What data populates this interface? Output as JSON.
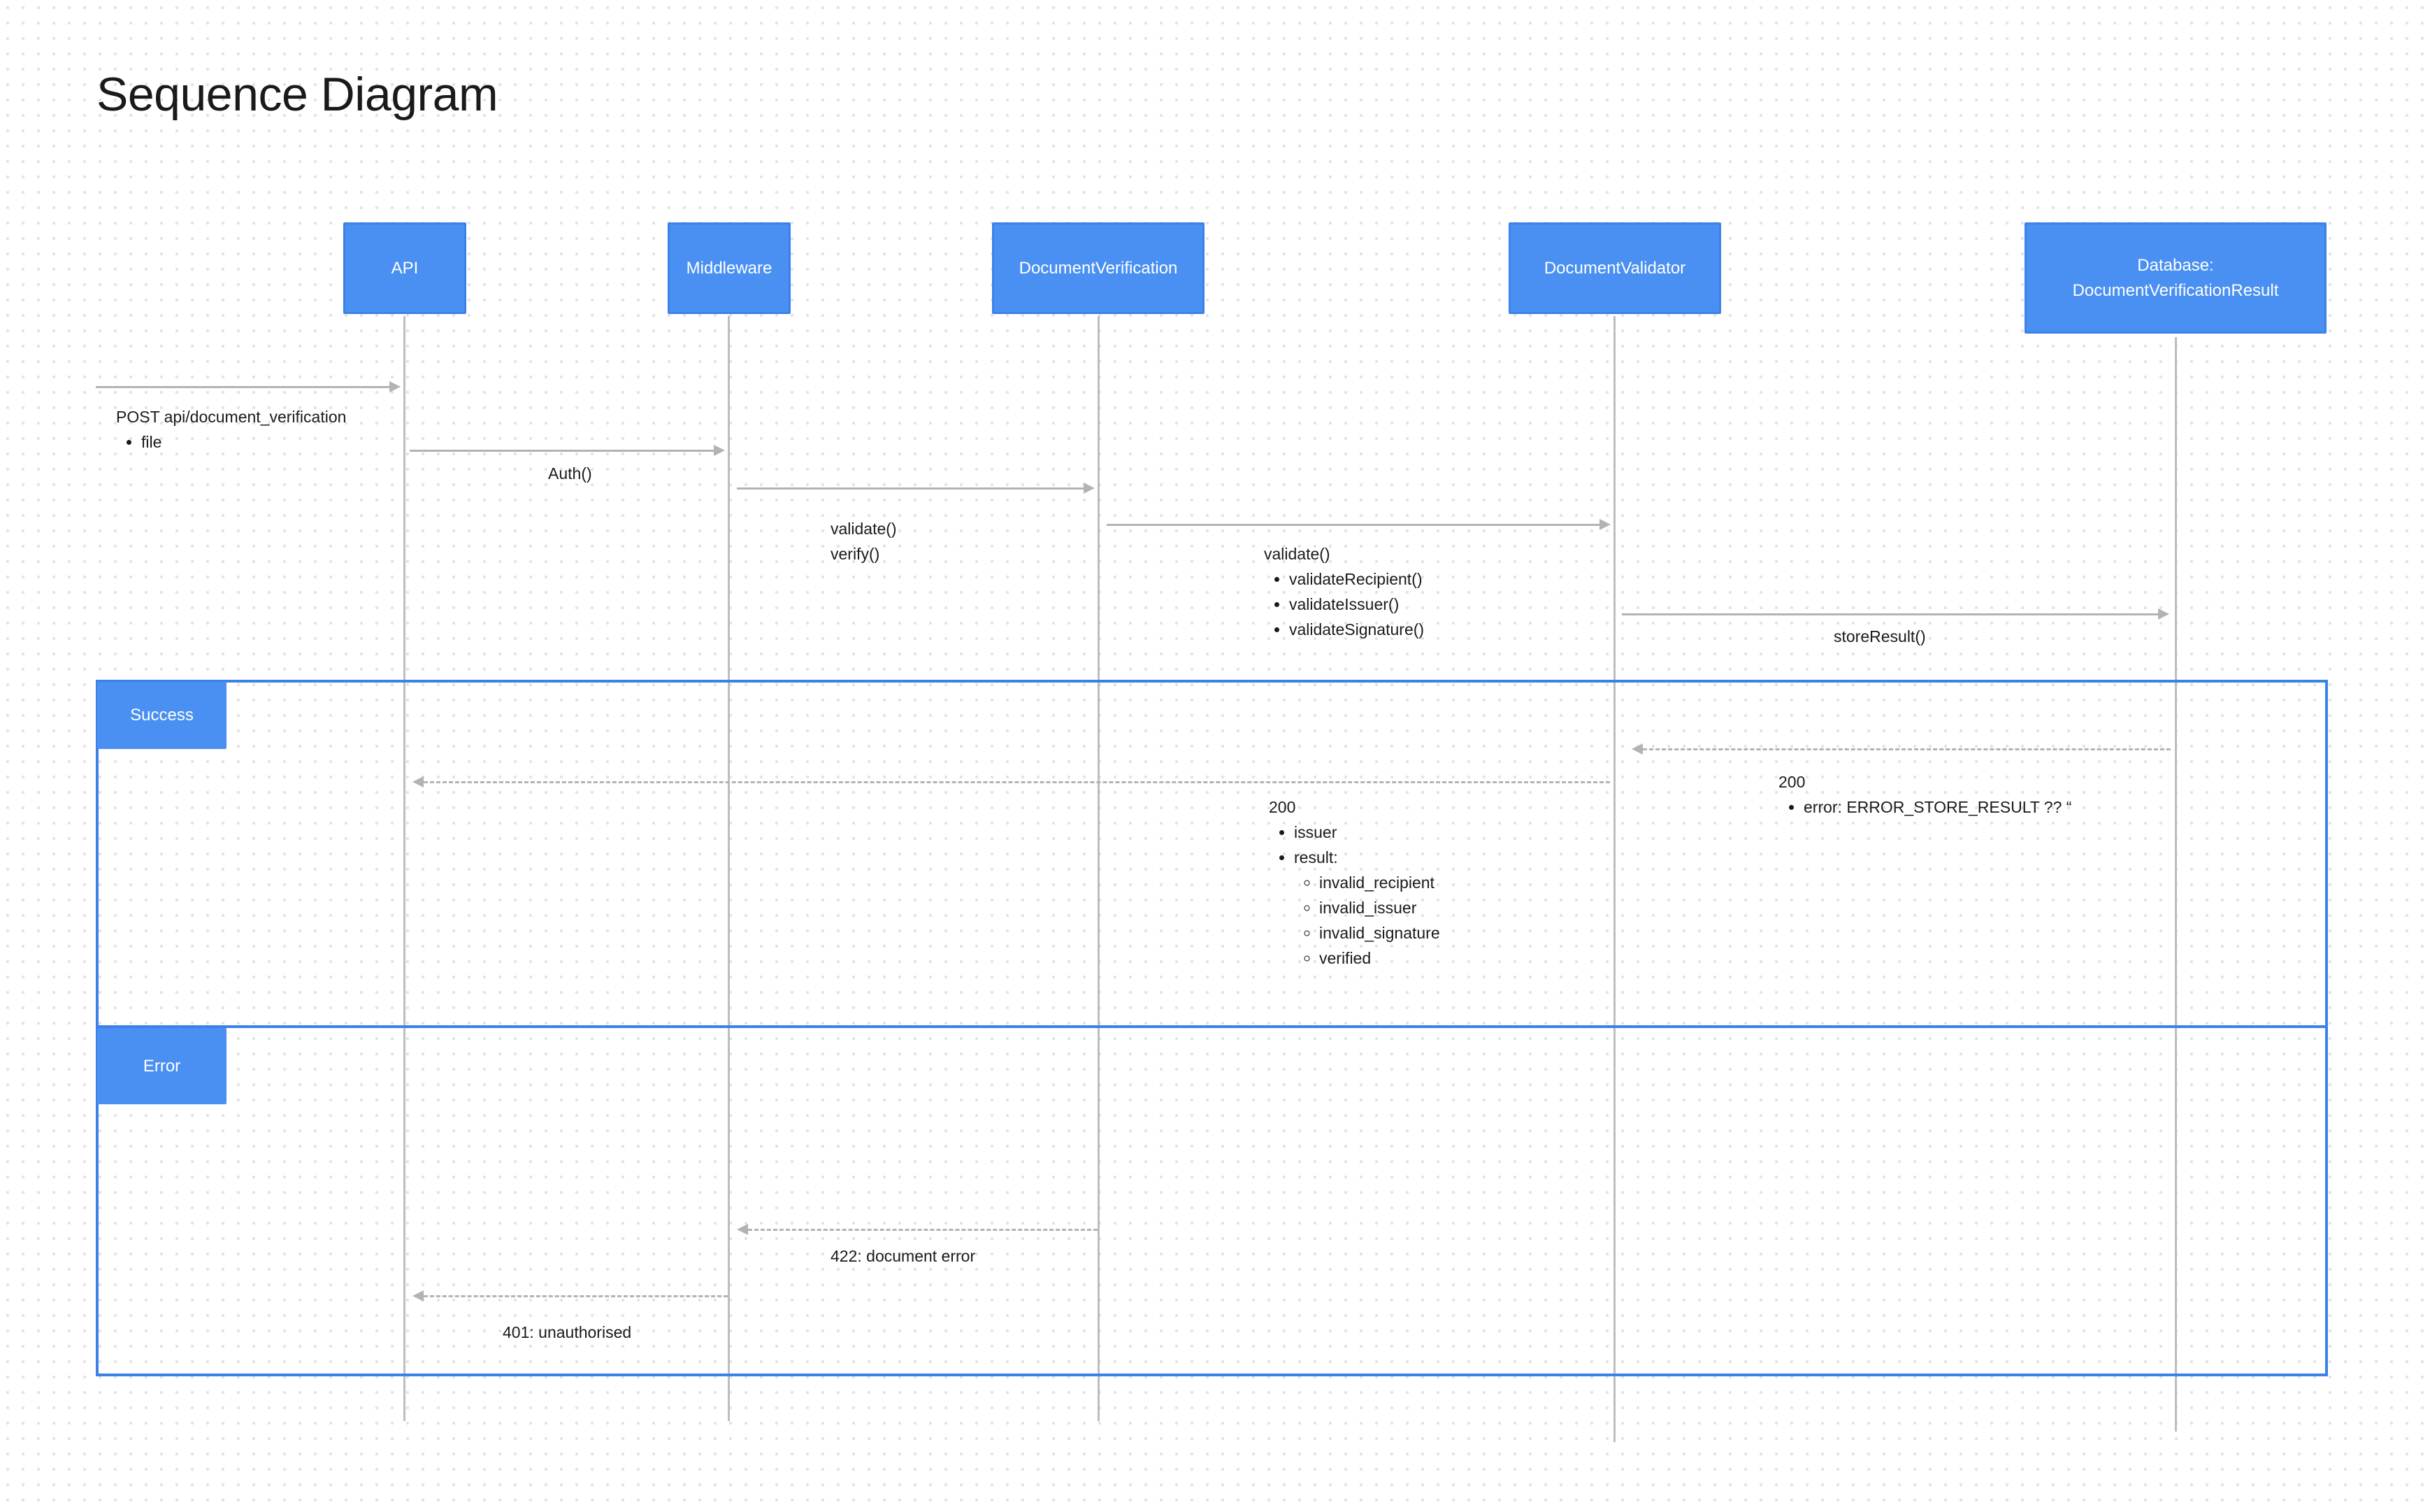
{
  "title": "Sequence Diagram",
  "participants": [
    {
      "name": "API"
    },
    {
      "name": "Middleware"
    },
    {
      "name": "DocumentVerification"
    },
    {
      "name": "DocumentValidator"
    },
    {
      "name": "Database:",
      "subtitle": "DocumentVerificationResult"
    }
  ],
  "frames": {
    "success": "Success",
    "error": "Error"
  },
  "messages": {
    "request": {
      "line": "POST api/document_verification",
      "bullet": "file"
    },
    "auth": "Auth()",
    "validate_verify": {
      "line1": "validate()",
      "line2": "verify()"
    },
    "validate": {
      "line": "validate()",
      "bullets": [
        "validateRecipient()",
        "validateIssuer()",
        "validateSignature()"
      ]
    },
    "store": "storeResult()",
    "db_response": {
      "line": "200",
      "bullet": "error: ERROR_STORE_RESULT ?? “"
    },
    "api_response": {
      "line": "200",
      "bullet_issuer": "issuer",
      "bullet_result": "result:",
      "results": [
        "invalid_recipient",
        "invalid_issuer",
        "invalid_signature",
        "verified"
      ]
    },
    "doc_error": "422: document error",
    "unauth": "401: unauthorised"
  },
  "colors": {
    "accent": "#4a90f2",
    "frame": "#3b82e8",
    "line": "#b3b3b3",
    "lifeline": "#bdbdbd"
  }
}
